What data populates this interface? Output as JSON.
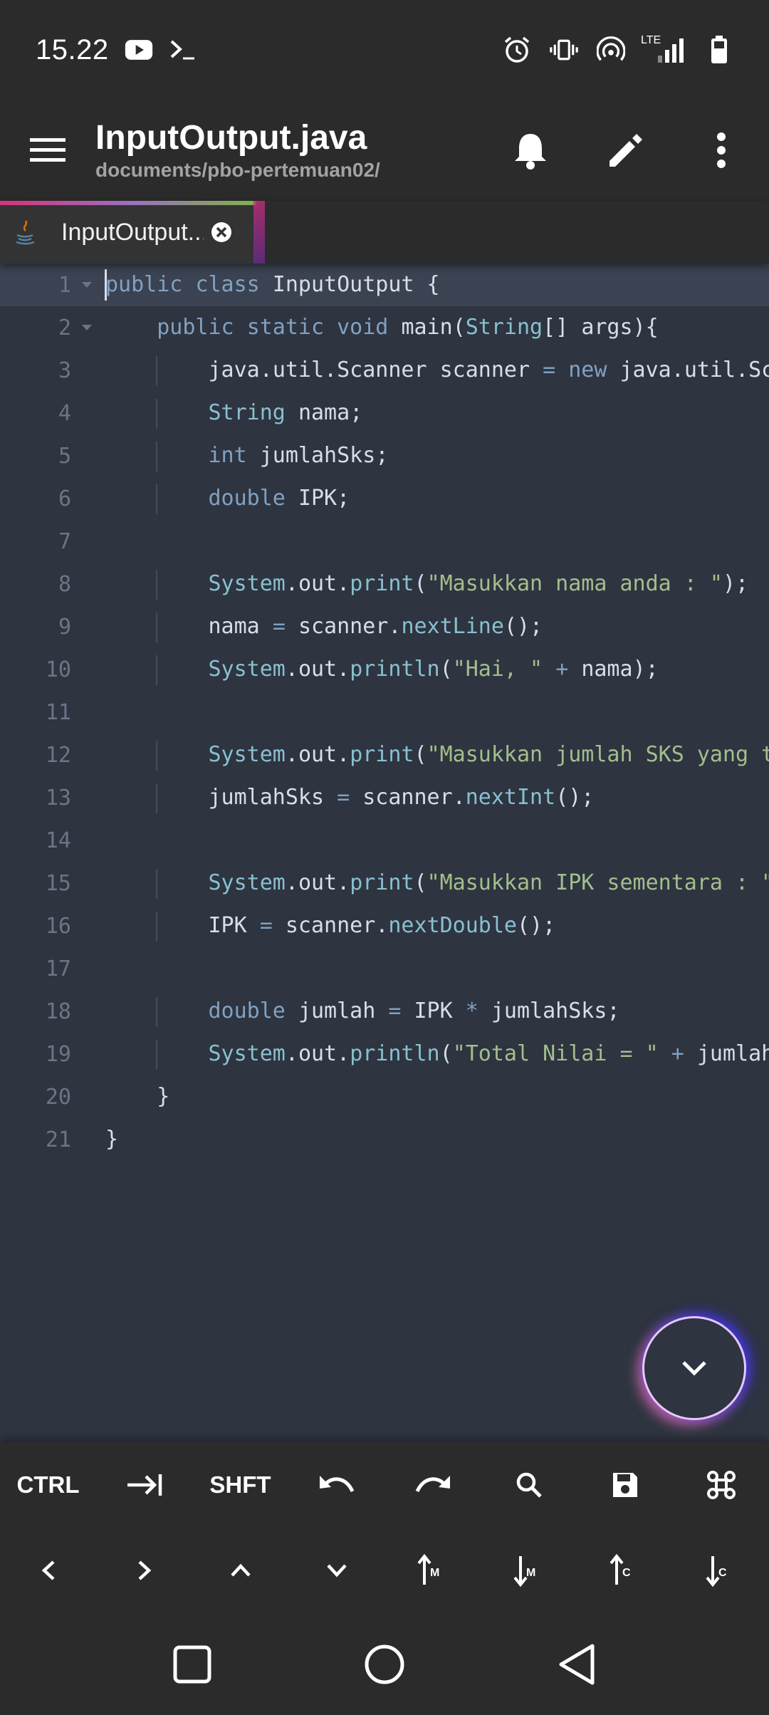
{
  "status_bar": {
    "time": "15.22",
    "icons_left": [
      "youtube-icon",
      "terminal-icon"
    ],
    "icons_right": [
      "alarm-icon",
      "vibrate-icon",
      "hotspot-icon",
      "lte-signal-icon",
      "battery-icon"
    ],
    "network_label": "LTE"
  },
  "app_bar": {
    "title": "InputOutput.java",
    "path": "documents/pbo-pertemuan02/",
    "actions": [
      "bell-icon",
      "edit-icon",
      "more-vert-icon"
    ]
  },
  "tabs": [
    {
      "label": "InputOutput...",
      "icon": "java-icon",
      "active": true
    }
  ],
  "editor": {
    "theme_colors": {
      "background": "#2e3440",
      "keyword": "#81a1c1",
      "string": "#a3be8c",
      "function": "#88c0d0"
    },
    "line_numbers": [
      "1",
      "2",
      "3",
      "4",
      "5",
      "6",
      "7",
      "8",
      "9",
      "10",
      "11",
      "12",
      "13",
      "14",
      "15",
      "16",
      "17",
      "18",
      "19",
      "20",
      "21"
    ],
    "lines": [
      "public class InputOutput {",
      "    public static void main(String[] args){",
      "        java.util.Scanner scanner = new java.util.Sc",
      "        String nama;",
      "        int jumlahSks;",
      "        double IPK;",
      "",
      "        System.out.print(\"Masukkan nama anda : \");",
      "        nama = scanner.nextLine();",
      "        System.out.println(\"Hai, \" + nama);",
      "",
      "        System.out.print(\"Masukkan jumlah SKS yang t",
      "        jumlahSks = scanner.nextInt();",
      "",
      "        System.out.print(\"Masukkan IPK sementara : \"",
      "        IPK = scanner.nextDouble();",
      "",
      "        double jumlah = IPK * jumlahSks;",
      "        System.out.println(\"Total Nilai = \" + jumlah",
      "    }",
      "}"
    ],
    "fold_lines": [
      1,
      2
    ],
    "active_line": 1
  },
  "fab": {
    "icon": "chevron-down-icon"
  },
  "extra_keys": {
    "row1": [
      {
        "label": "CTRL"
      },
      {
        "icon": "tab-icon"
      },
      {
        "label": "SHFT"
      },
      {
        "icon": "undo-icon"
      },
      {
        "icon": "redo-icon"
      },
      {
        "icon": "search-icon"
      },
      {
        "icon": "save-icon"
      },
      {
        "icon": "command-icon"
      }
    ],
    "row2": [
      {
        "icon": "arrow-left-icon"
      },
      {
        "icon": "arrow-right-icon"
      },
      {
        "icon": "arrow-up-icon"
      },
      {
        "icon": "arrow-down-icon"
      },
      {
        "icon": "move-up-m-icon",
        "sub": "M"
      },
      {
        "icon": "move-down-m-icon",
        "sub": "M"
      },
      {
        "icon": "move-up-c-icon",
        "sub": "C"
      },
      {
        "icon": "move-down-c-icon",
        "sub": "C"
      }
    ]
  },
  "nav_bar": [
    "recents-icon",
    "home-icon",
    "back-icon"
  ]
}
